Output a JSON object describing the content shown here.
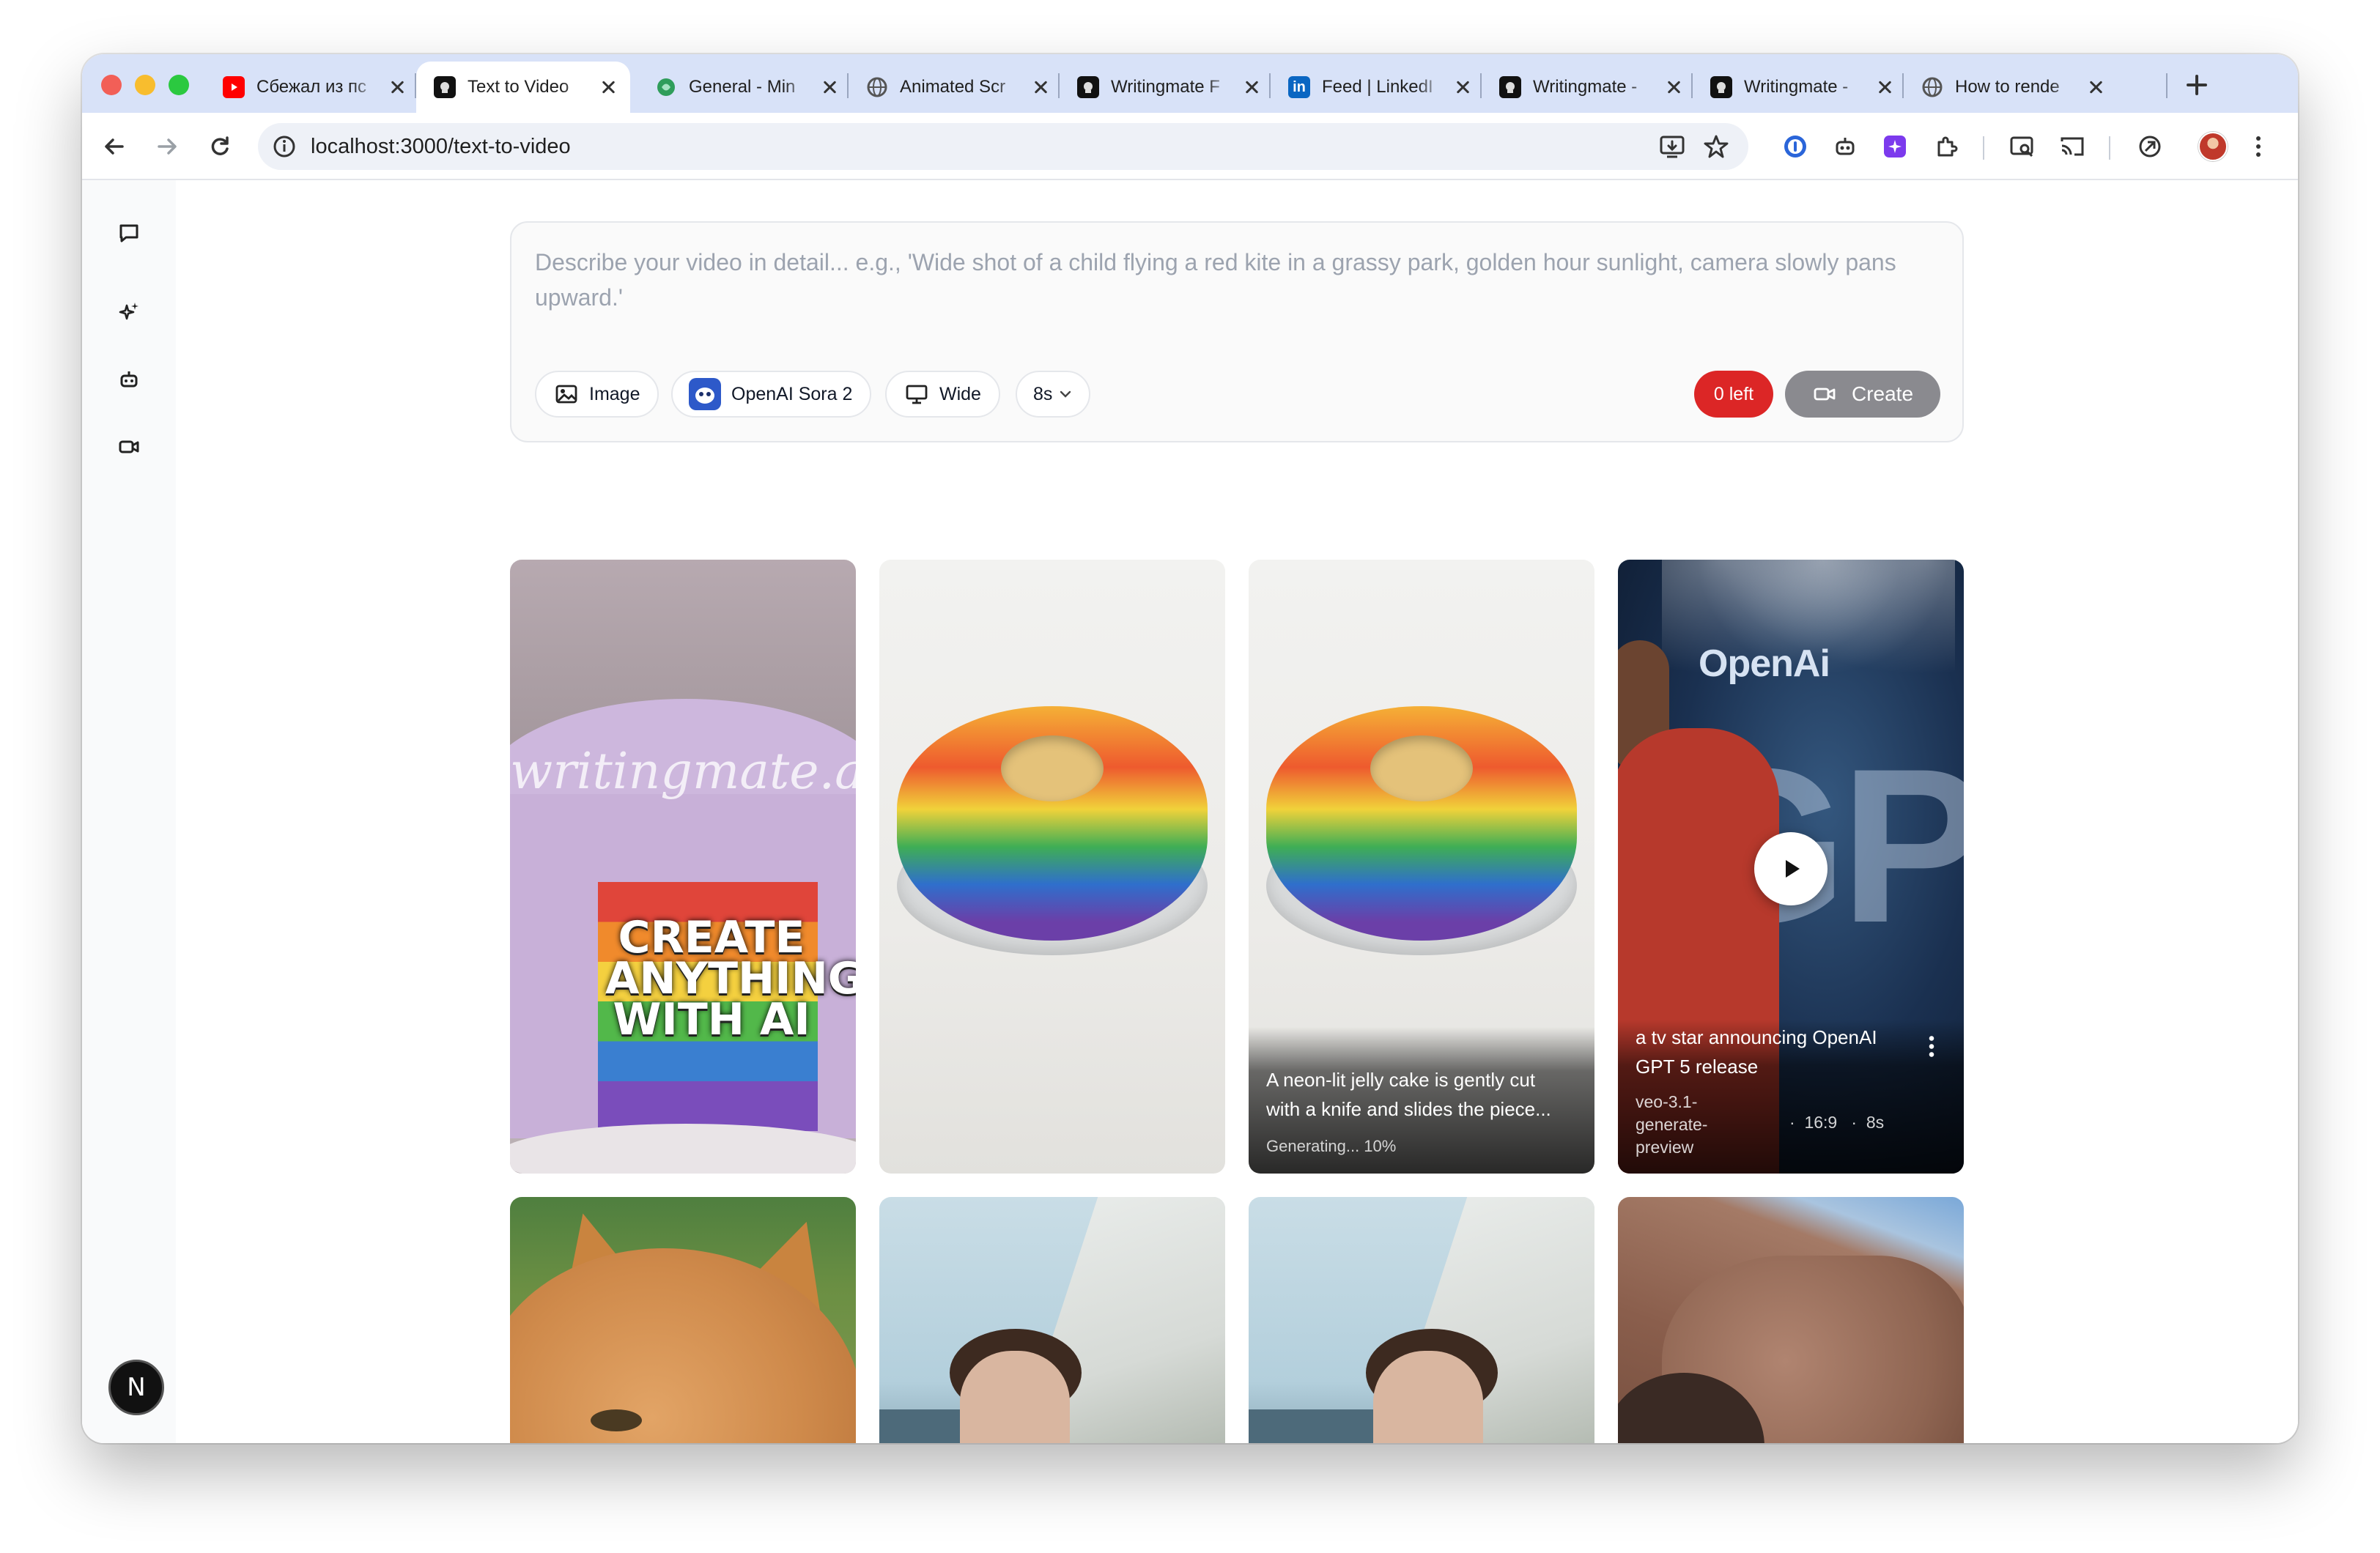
{
  "browser": {
    "tabs": [
      {
        "title": "Сбежал из пс",
        "favicon": "youtube-icon",
        "color": "#ff0000",
        "active": false
      },
      {
        "title": "Text to Video",
        "favicon": "writingmate-icon",
        "color": "#111111",
        "active": true
      },
      {
        "title": "General - Min",
        "favicon": "chat-icon",
        "color": "#2f9d5a",
        "active": false
      },
      {
        "title": "Animated Scr",
        "favicon": "globe-icon",
        "color": "#666666",
        "active": false
      },
      {
        "title": "Writingmate F",
        "favicon": "writingmate-icon",
        "color": "#111111",
        "active": false
      },
      {
        "title": "Feed | LinkedI",
        "favicon": "linkedin-icon",
        "color": "#0a66c2",
        "active": false
      },
      {
        "title": "Writingmate -",
        "favicon": "writingmate-icon",
        "color": "#111111",
        "active": false
      },
      {
        "title": "Writingmate -",
        "favicon": "writingmate-icon",
        "color": "#111111",
        "active": false
      },
      {
        "title": "How to rende",
        "favicon": "globe-icon",
        "color": "#666666",
        "active": false
      }
    ],
    "url": "localhost:3000/text-to-video"
  },
  "composer": {
    "placeholder": "Describe your video in detail... e.g., 'Wide shot of a child flying a red kite in a grassy park, golden hour sunlight, camera slowly pans upward.'",
    "image_label": "Image",
    "model_label": "OpenAI Sora 2",
    "aspect_label": "Wide",
    "duration_label": "8s",
    "credits_label": "0 left",
    "create_label": "Create"
  },
  "gallery": {
    "cake_script": "writingmate.ai",
    "cake_caption": "CREATE ANYTHING WITH AI",
    "generating_card": {
      "title": "A neon-lit jelly cake is gently cut with a knife and slides the piece...",
      "status": "Generating... 10%",
      "progress": 0.1
    },
    "featured_card": {
      "brand": "OpenAi",
      "backdrop_text": "GPT",
      "title": "a tv star announcing OpenAI GPT 5 release",
      "model": "veo-3.1-generate-preview",
      "aspect": "16:9",
      "duration": "8s"
    }
  },
  "colors": {
    "credits_badge": "#dc2626",
    "create_button": "#8a8a8f",
    "tabbar": "#d8e2f8"
  }
}
